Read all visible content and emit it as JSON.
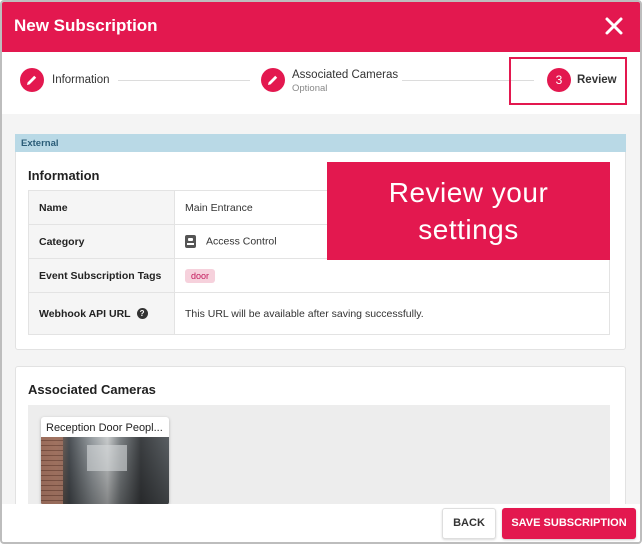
{
  "dialog": {
    "title": "New Subscription"
  },
  "stepper": {
    "steps": [
      {
        "label": "Information",
        "sublabel": "",
        "badge": ""
      },
      {
        "label": "Associated Cameras",
        "sublabel": "Optional",
        "badge": ""
      },
      {
        "label": "Review",
        "sublabel": "",
        "badge": "3"
      }
    ]
  },
  "external_label": "External",
  "information": {
    "title": "Information",
    "rows": [
      {
        "key": "Name",
        "value": "Main Entrance"
      },
      {
        "key": "Category",
        "value": "Access Control",
        "icon": "badge-icon"
      },
      {
        "key": "Event Subscription Tags",
        "tag": "door"
      },
      {
        "key": "Webhook API URL",
        "value": "This URL will be available after saving successfully.",
        "help_glyph": "?"
      }
    ]
  },
  "callout": {
    "line1": "Review your",
    "line2": "settings"
  },
  "cameras": {
    "title": "Associated Cameras",
    "items": [
      {
        "name": "Reception Door Peopl..."
      }
    ]
  },
  "footer": {
    "back_label": "BACK",
    "save_label": "SAVE SUBSCRIPTION"
  },
  "colors": {
    "accent": "#e3184f",
    "external_bar": "#b9d9e6"
  }
}
